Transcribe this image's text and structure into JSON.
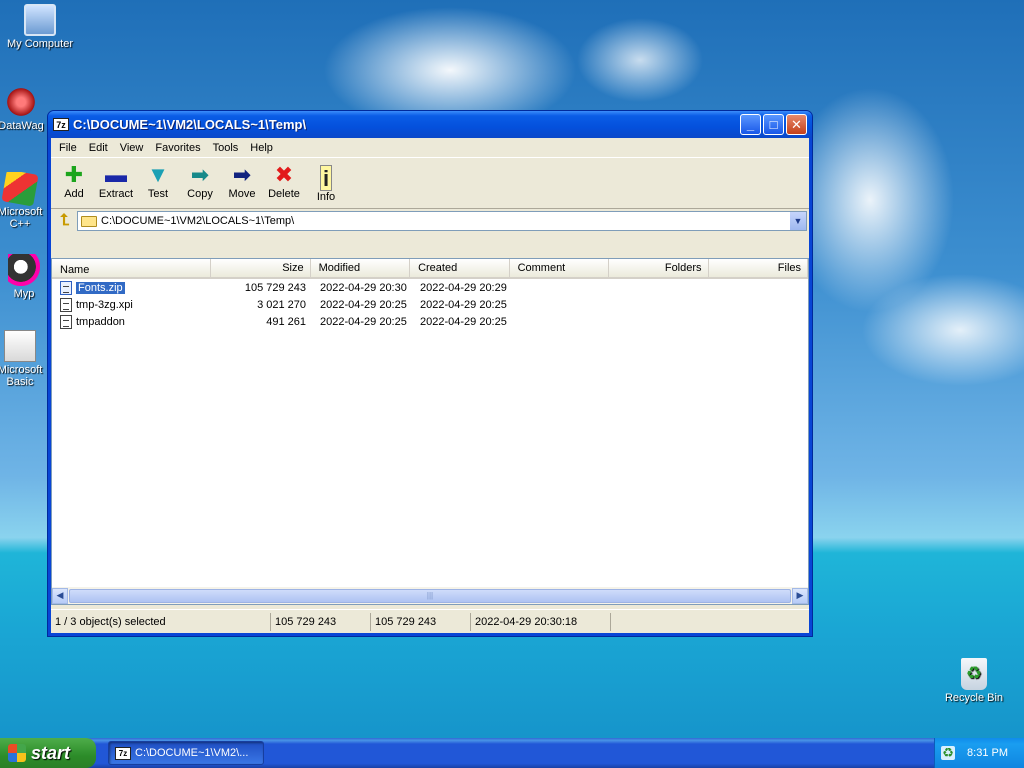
{
  "desktop": {
    "icons": [
      {
        "label": "My Computer",
        "icon": "computer-icon"
      },
      {
        "label": "DataWag",
        "icon": "data-app-icon"
      },
      {
        "label": "Microsoft C++",
        "icon": "msvc-icon"
      },
      {
        "label": "Myp",
        "icon": "paint-app-icon"
      },
      {
        "label": "Microsoft Basic",
        "icon": "vb-icon"
      },
      {
        "label": "Recycle Bin",
        "icon": "recycle-bin-icon"
      }
    ]
  },
  "window": {
    "badge": "7z",
    "title": "C:\\DOCUME~1\\VM2\\LOCALS~1\\Temp\\",
    "controls": {
      "minimize": "_",
      "maximize": "□",
      "close": "✕"
    },
    "menu": [
      "File",
      "Edit",
      "View",
      "Favorites",
      "Tools",
      "Help"
    ],
    "toolbar": [
      {
        "label": "Add",
        "glyph": "✚",
        "icon": "add-icon"
      },
      {
        "label": "Extract",
        "glyph": "▬",
        "icon": "extract-icon"
      },
      {
        "label": "Test",
        "glyph": "▼",
        "icon": "test-icon"
      },
      {
        "label": "Copy",
        "glyph": "➡",
        "icon": "copy-icon"
      },
      {
        "label": "Move",
        "glyph": "➡",
        "icon": "move-icon"
      },
      {
        "label": "Delete",
        "glyph": "✖",
        "icon": "delete-icon"
      },
      {
        "label": "Info",
        "glyph": "i",
        "icon": "info-icon"
      }
    ],
    "address": "C:\\DOCUME~1\\VM2\\LOCALS~1\\Temp\\",
    "up_glyph": "⮤",
    "dropdown_glyph": "▼",
    "columns": [
      "Name",
      "Size",
      "Modified",
      "Created",
      "Comment",
      "Folders",
      "Files"
    ],
    "rows": [
      {
        "name": "Fonts.zip",
        "size": "105 729 243",
        "modified": "2022-04-29 20:30",
        "created": "2022-04-29 20:29",
        "type": "zip",
        "selected": true
      },
      {
        "name": "tmp-3zg.xpi",
        "size": "3 021 270",
        "modified": "2022-04-29 20:25",
        "created": "2022-04-29 20:25",
        "type": "file",
        "selected": false
      },
      {
        "name": "tmpaddon",
        "size": "491 261",
        "modified": "2022-04-29 20:25",
        "created": "2022-04-29 20:25",
        "type": "file",
        "selected": false
      }
    ],
    "status": {
      "selection": "1 / 3 object(s) selected",
      "size": "105 729 243",
      "packed": "105 729 243",
      "modified": "2022-04-29 20:30:18"
    },
    "scroll": {
      "left": "◀",
      "right": "▶",
      "grip": "|||"
    }
  },
  "taskbar": {
    "start_label": "start",
    "task_badge": "7z",
    "task_label": "C:\\DOCUME~1\\VM2\\...",
    "clock": "8:31 PM",
    "tray_glyph": "♻"
  }
}
